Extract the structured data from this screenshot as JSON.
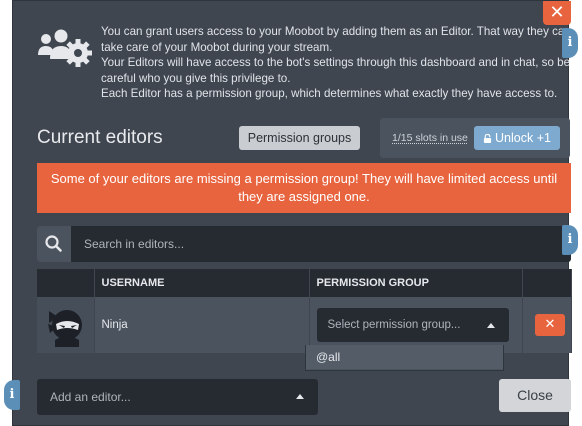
{
  "header": {
    "close_glyph": "✕",
    "info_glyph": "i"
  },
  "intro": {
    "icon": "users-gear-icon",
    "lines": [
      "You can grant users access to your Moobot by adding them as an Editor. That way they can take care of your Moobot during your stream.",
      "Your Editors will have access to the bot's settings through this dashboard and in chat, so be careful who you give this privilege to.",
      "Each Editor has a permission group, which determines what exactly they have access to."
    ]
  },
  "editors_section": {
    "title": "Current editors",
    "permission_groups_label": "Permission groups",
    "slots_text": "1/15 slots in use",
    "unlock_label": "Unlock +1"
  },
  "alert": {
    "text": "Some of your editors are missing a permission group! They will have limited access until they are assigned one."
  },
  "search": {
    "placeholder": "Search in editors..."
  },
  "table": {
    "columns": [
      "",
      "USERNAME",
      "PERMISSION GROUP",
      ""
    ],
    "rows": [
      {
        "avatar": "ninja-avatar",
        "username": "Ninja",
        "permission_placeholder": "Select permission group...",
        "remove_glyph": "✕"
      }
    ]
  },
  "dropdown": {
    "options": [
      "@all"
    ]
  },
  "footer": {
    "add_editor_placeholder": "Add an editor...",
    "close_label": "Close"
  },
  "colors": {
    "background": "#3f4650",
    "dark_field": "#262b31",
    "accent_orange": "#e8643f",
    "accent_blue": "#7faad0"
  }
}
